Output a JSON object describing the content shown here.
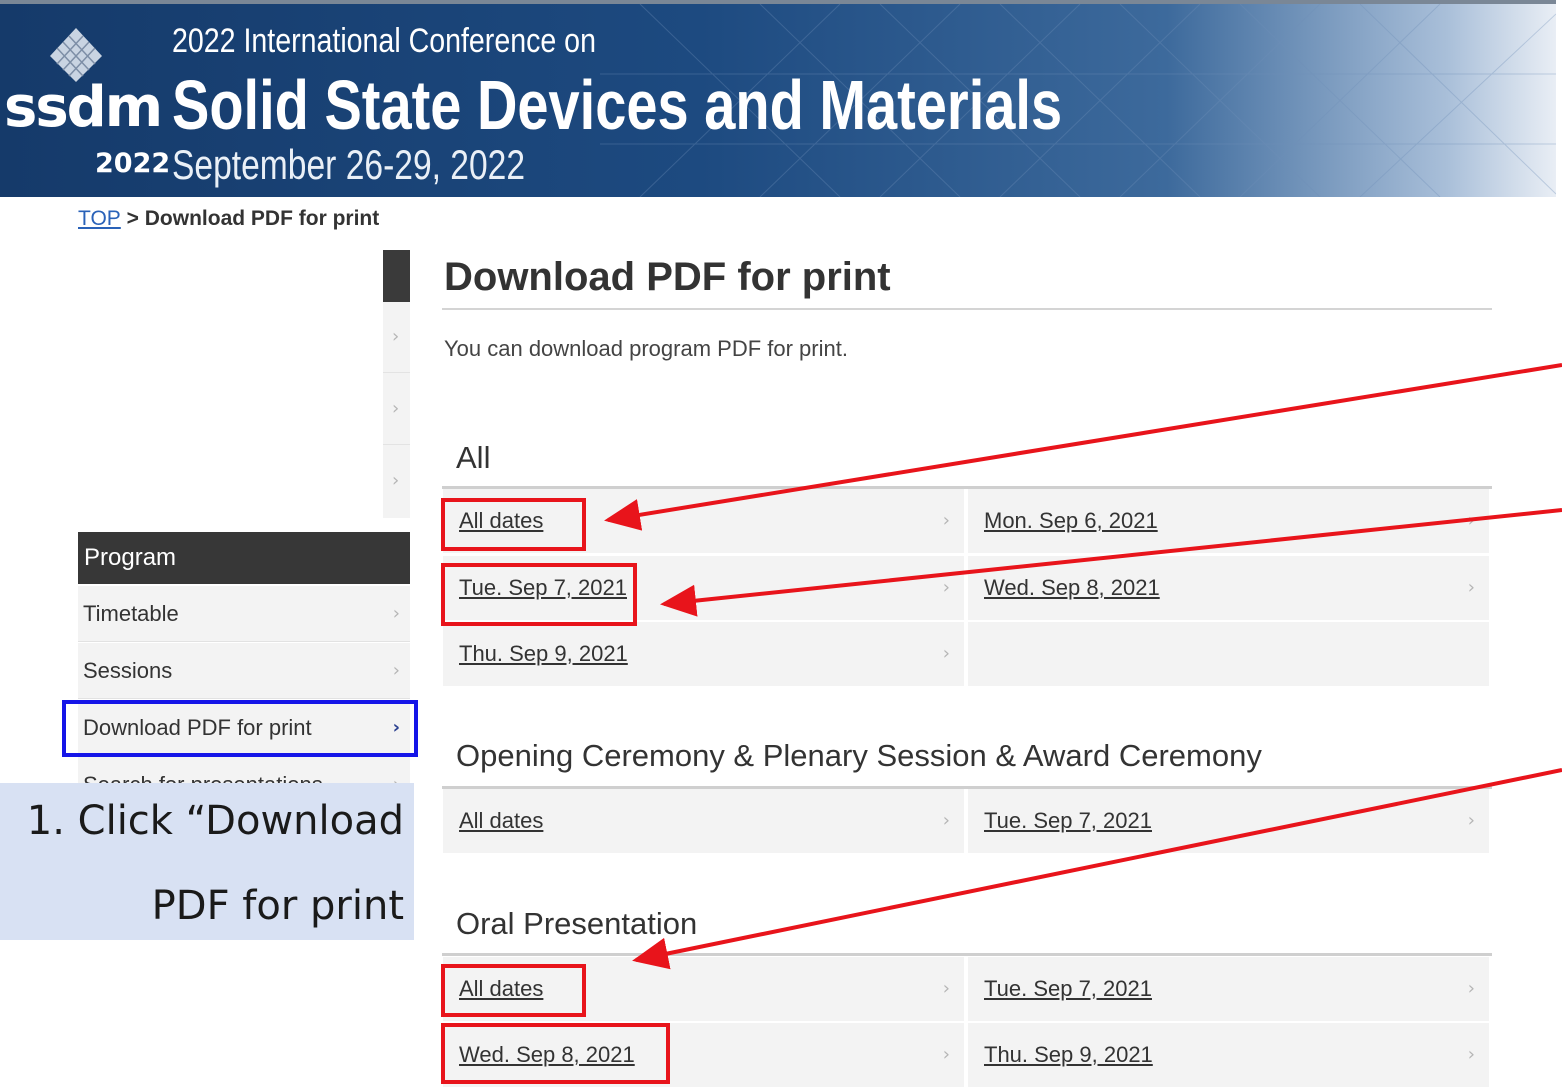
{
  "banner": {
    "logo_text": "ssdm",
    "logo_year": "2022",
    "line1": "2022 International Conference on",
    "line2": "Solid State Devices and Materials",
    "line3": "September 26-29, 2022"
  },
  "breadcrumb": {
    "top_link": "TOP",
    "separator": ">",
    "current": "Download PDF for print"
  },
  "sidebar": {
    "header": "Program",
    "items": [
      {
        "label": "Timetable"
      },
      {
        "label": "Sessions"
      },
      {
        "label": "Download PDF for print",
        "active": true
      },
      {
        "label": "Search for presentations"
      }
    ]
  },
  "callout": {
    "line1": "1. Click “Download",
    "line2": "PDF for print"
  },
  "main": {
    "title": "Download PDF for print",
    "intro": "You can download program PDF for print.",
    "sections": [
      {
        "heading": "All",
        "links": [
          "All dates",
          "Mon. Sep 6, 2021",
          "Tue. Sep 7, 2021",
          "Wed. Sep 8, 2021",
          "Thu. Sep 9, 2021"
        ]
      },
      {
        "heading": "Opening Ceremony & Plenary Session & Award Ceremony",
        "links": [
          "All dates",
          "Tue. Sep 7, 2021"
        ]
      },
      {
        "heading": "Oral Presentation",
        "links": [
          "All dates",
          "Tue. Sep 7, 2021",
          "Wed. Sep 8, 2021",
          "Thu. Sep 9, 2021"
        ]
      }
    ]
  },
  "colors": {
    "banner_blue": "#1d4a80",
    "highlight_red": "#e8141b",
    "highlight_blue": "#1515e8",
    "callout_bg": "#d8e1f3"
  },
  "icons": [
    "logo-diamond-icon",
    "chevron-right-icon"
  ]
}
